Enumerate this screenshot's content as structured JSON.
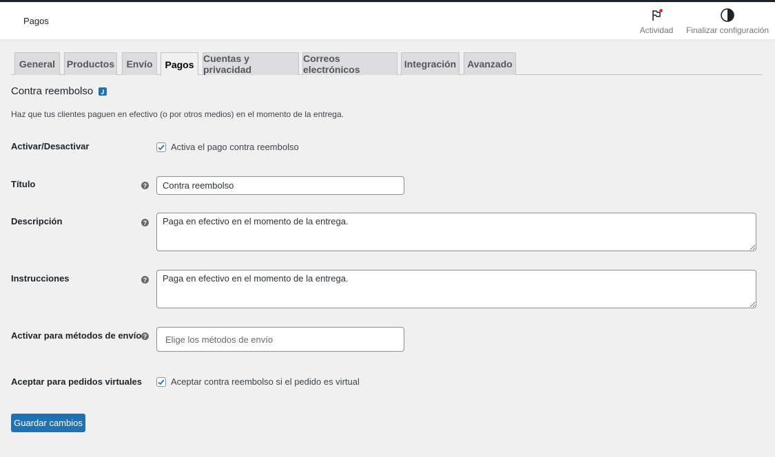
{
  "header": {
    "title": "Pagos",
    "activity_label": "Actividad",
    "setup_label": "Finalizar configuración"
  },
  "tabs": [
    {
      "label": "General",
      "active": false
    },
    {
      "label": "Productos",
      "active": false
    },
    {
      "label": "Envío",
      "active": false
    },
    {
      "label": "Pagos",
      "active": true
    },
    {
      "label": "Cuentas y privacidad",
      "active": false
    },
    {
      "label": "Correos electrónicos",
      "active": false
    },
    {
      "label": "Integración",
      "active": false
    },
    {
      "label": "Avanzado",
      "active": false
    }
  ],
  "section": {
    "title": "Contra reembolso",
    "description": "Haz que tus clientes paguen en efectivo (o por otros medios) en el momento de la entrega."
  },
  "fields": {
    "enable": {
      "label": "Activar/Desactivar",
      "checkbox_label": "Activa el pago contra reembolso",
      "checked": true
    },
    "title": {
      "label": "Título",
      "value": "Contra reembolso"
    },
    "description": {
      "label": "Descripción",
      "value": "Paga en efectivo en el momento de la entrega."
    },
    "instructions": {
      "label": "Instrucciones",
      "value": "Paga en efectivo en el momento de la entrega."
    },
    "shipping_methods": {
      "label": "Activar para métodos de envío",
      "placeholder": "Elige los métodos de envío"
    },
    "virtual": {
      "label": "Aceptar para pedidos virtuales",
      "checkbox_label": "Aceptar contra reembolso si el pedido es virtual",
      "checked": true
    }
  },
  "save_label": "Guardar cambios",
  "colors": {
    "accent": "#2271b1",
    "notification_dot": "#d63638"
  }
}
